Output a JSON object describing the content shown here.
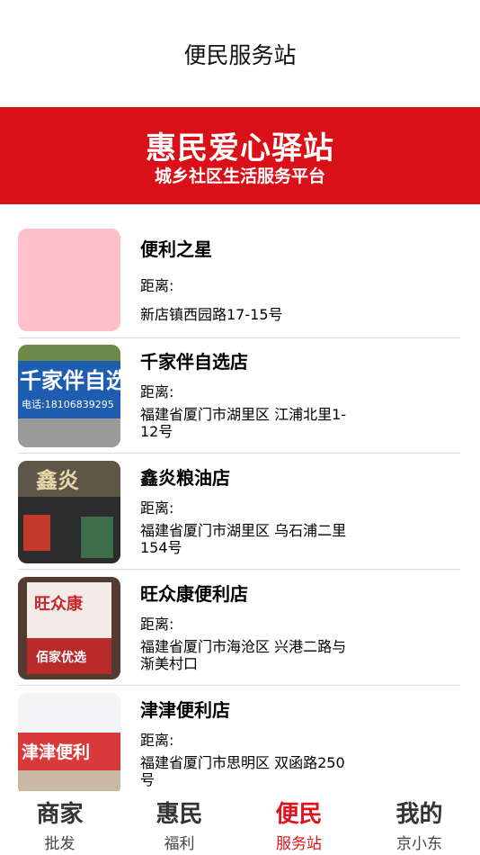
{
  "header": {
    "title": "便民服务站"
  },
  "banner": {
    "line1": "惠民爱心驿站",
    "line2": "城乡社区生活服务平台"
  },
  "stores": [
    {
      "name": "便利之星",
      "distance_label": "距离:",
      "address": "新店镇西园路17-15号"
    },
    {
      "name": "千家伴自选店",
      "distance_label": "距离:",
      "address": "福建省厦门市湖里区 江浦北里1-12号",
      "sign_text": "千家伴自选",
      "sign_phone": "电话:18106839295"
    },
    {
      "name": "鑫炎粮油店",
      "distance_label": "距离:",
      "address": "福建省厦门市湖里区 乌石浦二里154号",
      "sign_text": "鑫炎"
    },
    {
      "name": "旺众康便利店",
      "distance_label": "距离:",
      "address": "福建省厦门市海沧区 兴港二路与渐美村口",
      "sign_text": "旺众康",
      "sign_sub": "佰家优选"
    },
    {
      "name": "津津便利店",
      "distance_label": "距离:",
      "address": "福建省厦门市思明区 双函路250号",
      "sign_text": "津津便利"
    }
  ],
  "tabs": [
    {
      "big": "商家",
      "small": "批发",
      "active": false
    },
    {
      "big": "惠民",
      "small": "福利",
      "active": false
    },
    {
      "big": "便民",
      "small": "服务站",
      "active": true
    },
    {
      "big": "我的",
      "small": "京小东",
      "active": false
    }
  ],
  "colors": {
    "brand_red": "#da1018",
    "active_tab": "#e0141c",
    "placeholder_thumb": "#ffc0cb"
  }
}
